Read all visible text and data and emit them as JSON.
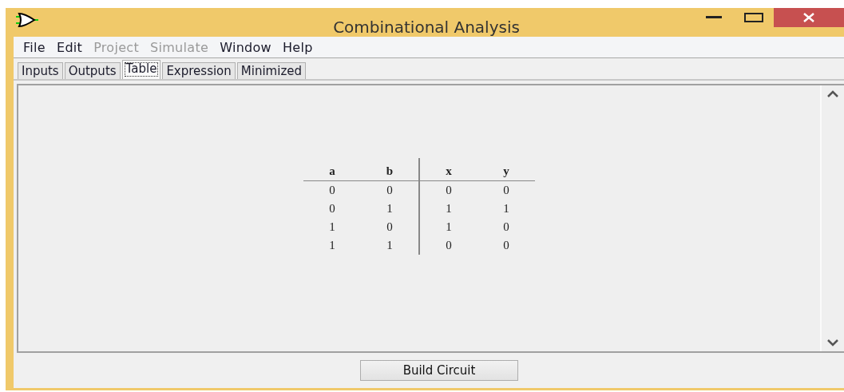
{
  "window": {
    "title": "Combinational Analysis"
  },
  "menu": [
    {
      "label": "File",
      "disabled": false
    },
    {
      "label": "Edit",
      "disabled": false
    },
    {
      "label": "Project",
      "disabled": true
    },
    {
      "label": "Simulate",
      "disabled": true
    },
    {
      "label": "Window",
      "disabled": false
    },
    {
      "label": "Help",
      "disabled": false
    }
  ],
  "tabs": [
    {
      "label": "Inputs",
      "selected": false
    },
    {
      "label": "Outputs",
      "selected": false
    },
    {
      "label": "Table",
      "selected": true
    },
    {
      "label": "Expression",
      "selected": false
    },
    {
      "label": "Minimized",
      "selected": false
    }
  ],
  "table": {
    "inputs": [
      "a",
      "b"
    ],
    "outputs": [
      "x",
      "y"
    ],
    "rows": [
      [
        "0",
        "0",
        "0",
        "0"
      ],
      [
        "0",
        "1",
        "1",
        "1"
      ],
      [
        "1",
        "0",
        "1",
        "0"
      ],
      [
        "1",
        "1",
        "0",
        "0"
      ]
    ]
  },
  "buttons": [
    "Build Circuit"
  ]
}
